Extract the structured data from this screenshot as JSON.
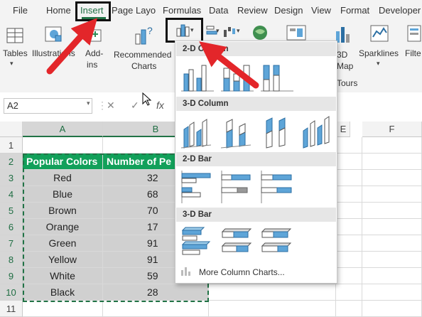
{
  "ribbon_tabs": [
    "File",
    "Home",
    "Insert",
    "Page Layo",
    "Formulas",
    "Data",
    "Review",
    "Design",
    "View",
    "Format",
    "Developer"
  ],
  "ribbon_groups": {
    "tables": "Tables",
    "illustrations": "Illustrations",
    "addins_line1": "Add-",
    "addins_line2": "ins",
    "recommended_line1": "Recommended",
    "recommended_line2": "Charts",
    "map_line1": "3D",
    "map_line2": "Map",
    "tours_label": "Tours",
    "sparklines": "Sparklines",
    "filters": "Filte"
  },
  "formula_bar": {
    "name_box": "A2",
    "cancel_icon": "cancel-icon",
    "enter_icon": "checkmark-icon",
    "function_label": "fx"
  },
  "columns": [
    "A",
    "B",
    "E",
    "F"
  ],
  "rows": [
    "1",
    "2",
    "3",
    "4",
    "5",
    "6",
    "7",
    "8",
    "9",
    "10",
    "11"
  ],
  "table": {
    "headers": [
      "Popular Colors",
      "Number of Pe"
    ],
    "rows": [
      [
        "Red",
        "32"
      ],
      [
        "Blue",
        "68"
      ],
      [
        "Brown",
        "70"
      ],
      [
        "Orange",
        "17"
      ],
      [
        "Green",
        "91"
      ],
      [
        "Yellow",
        "91"
      ],
      [
        "White",
        "59"
      ],
      [
        "Black",
        "28"
      ]
    ]
  },
  "column_menu": {
    "sections": [
      "2-D Column",
      "3-D Column",
      "2-D Bar",
      "3-D Bar"
    ],
    "more": "More Column Charts..."
  },
  "colors": {
    "excel_green": "#217346",
    "header_fill": "#12a05a",
    "data_fill": "#d0d0d0",
    "annotation_red": "#e3262a",
    "chart_blue": "#5ea5d8"
  }
}
